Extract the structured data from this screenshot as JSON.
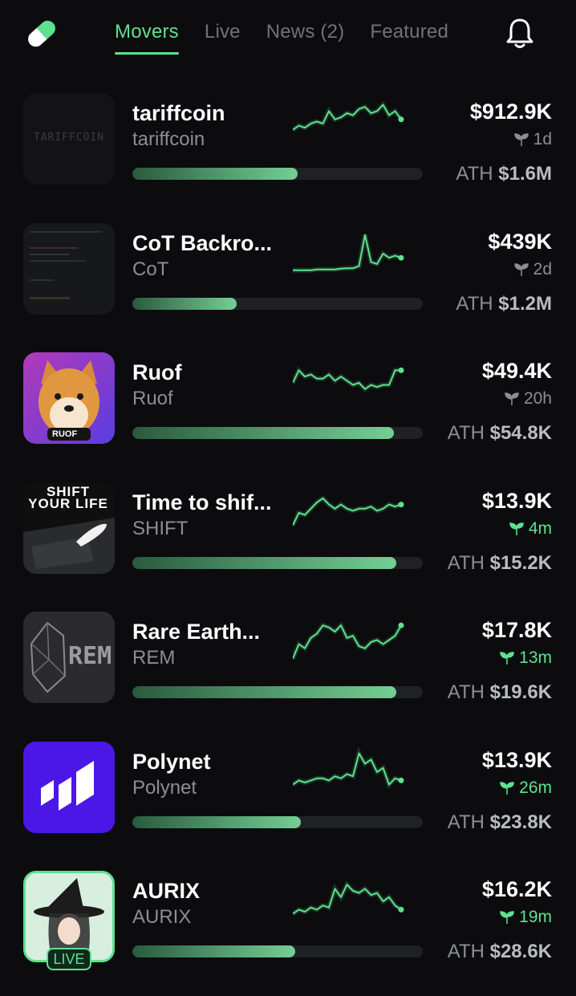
{
  "tabs": [
    {
      "label": "Movers",
      "active": true
    },
    {
      "label": "Live",
      "active": false
    },
    {
      "label": "News (2)",
      "active": false
    },
    {
      "label": "Featured",
      "active": false
    }
  ],
  "icons": {
    "logo": "pill-icon",
    "bell": "bell-icon",
    "age": "sprout-icon"
  },
  "colors": {
    "accent": "#5fe18f",
    "background": "#0c0c0f",
    "muted": "#8b8e94"
  },
  "ath_prefix": "ATH",
  "items": [
    {
      "name": "tariffcoin",
      "ticker": "tariffcoin",
      "price": "$912.9K",
      "age": "1d",
      "age_fresh": false,
      "ath": "$1.6M",
      "progress": 0.57,
      "thumb_text": "TARIFFCOIN",
      "trend": [
        0.35,
        0.45,
        0.4,
        0.5,
        0.55,
        0.5,
        0.8,
        0.6,
        0.65,
        0.75,
        0.7,
        0.85,
        0.9,
        0.75,
        0.8,
        0.95,
        0.7,
        0.8,
        0.6
      ]
    },
    {
      "name": "CoT Backro...",
      "ticker": "CoT",
      "price": "$439K",
      "age": "2d",
      "age_fresh": false,
      "ath": "$1.2M",
      "progress": 0.36,
      "thumb_text": "",
      "trend": [
        0.1,
        0.1,
        0.1,
        0.1,
        0.12,
        0.12,
        0.12,
        0.12,
        0.14,
        0.15,
        0.15,
        0.2,
        0.95,
        0.3,
        0.25,
        0.5,
        0.4,
        0.45,
        0.4
      ]
    },
    {
      "name": "Ruof",
      "ticker": "Ruof",
      "price": "$49.4K",
      "age": "20h",
      "age_fresh": false,
      "ath": "$54.8K",
      "progress": 0.9,
      "thumb_text": "RUOF",
      "trend": [
        0.5,
        0.8,
        0.65,
        0.7,
        0.6,
        0.6,
        0.7,
        0.55,
        0.65,
        0.55,
        0.45,
        0.5,
        0.35,
        0.45,
        0.4,
        0.45,
        0.45,
        0.8,
        0.8
      ]
    },
    {
      "name": "Time to shif...",
      "ticker": "SHIFT",
      "price": "$13.9K",
      "age": "4m",
      "age_fresh": true,
      "ath": "$15.2K",
      "progress": 0.91,
      "thumb_text": "SHIFT YOUR LIFE",
      "trend": [
        0.2,
        0.5,
        0.45,
        0.6,
        0.75,
        0.85,
        0.7,
        0.6,
        0.7,
        0.6,
        0.55,
        0.6,
        0.6,
        0.65,
        0.55,
        0.6,
        0.7,
        0.65,
        0.7
      ]
    },
    {
      "name": "Rare Earth...",
      "ticker": "REM",
      "price": "$17.8K",
      "age": "13m",
      "age_fresh": true,
      "ath": "$19.6K",
      "progress": 0.91,
      "thumb_text": "REM",
      "trend": [
        0.1,
        0.45,
        0.35,
        0.6,
        0.7,
        0.9,
        0.85,
        0.75,
        0.9,
        0.6,
        0.65,
        0.4,
        0.35,
        0.5,
        0.55,
        0.45,
        0.55,
        0.65,
        0.9
      ]
    },
    {
      "name": "Polynet",
      "ticker": "Polynet",
      "price": "$13.9K",
      "age": "26m",
      "age_fresh": true,
      "ath": "$23.8K",
      "progress": 0.58,
      "thumb_text": "",
      "trend": [
        0.2,
        0.3,
        0.25,
        0.3,
        0.35,
        0.35,
        0.3,
        0.4,
        0.35,
        0.45,
        0.4,
        0.95,
        0.7,
        0.8,
        0.5,
        0.6,
        0.2,
        0.35,
        0.3
      ]
    },
    {
      "name": "AURIX",
      "ticker": "AURIX",
      "price": "$16.2K",
      "age": "19m",
      "age_fresh": true,
      "ath": "$28.6K",
      "progress": 0.56,
      "thumb_text": "",
      "trend": [
        0.2,
        0.3,
        0.25,
        0.35,
        0.3,
        0.4,
        0.35,
        0.8,
        0.6,
        0.9,
        0.75,
        0.7,
        0.8,
        0.65,
        0.7,
        0.5,
        0.6,
        0.4,
        0.3
      ]
    }
  ],
  "live_badge": "LIVE"
}
